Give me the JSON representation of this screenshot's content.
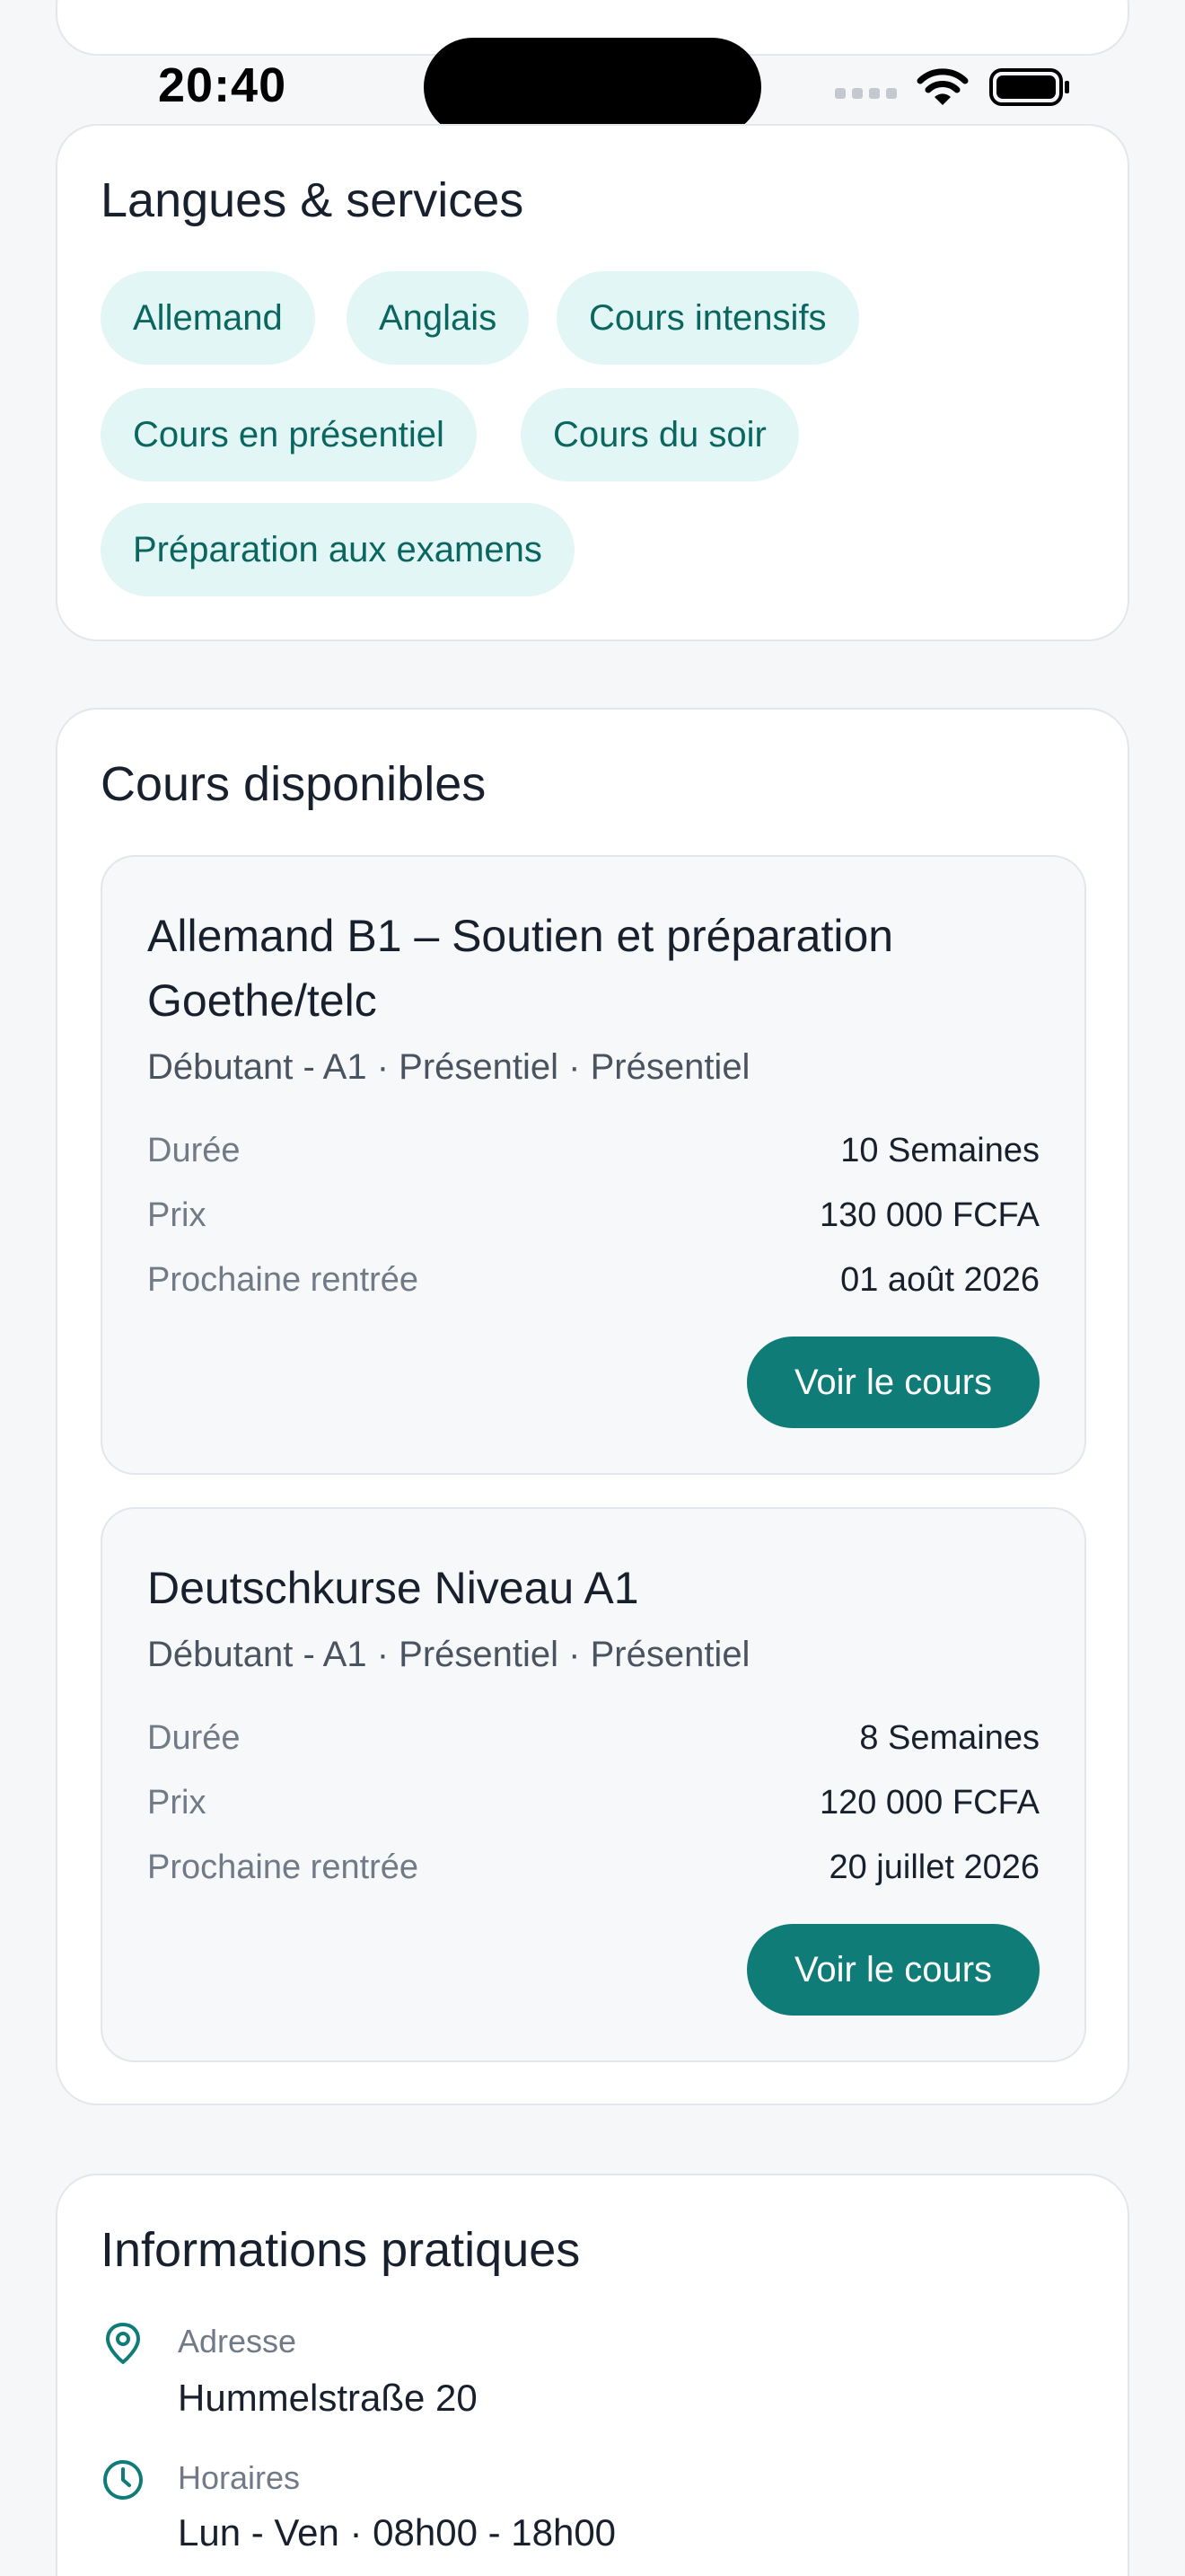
{
  "status_bar": {
    "time": "20:40"
  },
  "languages_card": {
    "title": "Langues & services",
    "chips": [
      "Allemand",
      "Anglais",
      "Cours intensifs",
      "Cours en présentiel",
      "Cours du soir",
      "Préparation aux examens"
    ]
  },
  "courses_card": {
    "title": "Cours disponibles",
    "courses": [
      {
        "title": "Allemand B1 – Soutien et préparation Goethe/telc",
        "meta": "Débutant - A1 · Présentiel · Présentiel",
        "duration_label": "Durée",
        "duration_value": "10 Semaines",
        "price_label": "Prix",
        "price_value": "130 000 FCFA",
        "start_label": "Prochaine rentrée",
        "start_value": "01 août 2026",
        "button_label": "Voir le cours"
      },
      {
        "title": "Deutschkurse Niveau A1",
        "meta": "Débutant - A1 · Présentiel · Présentiel",
        "duration_label": "Durée",
        "duration_value": "8 Semaines",
        "price_label": "Prix",
        "price_value": "120 000 FCFA",
        "start_label": "Prochaine rentrée",
        "start_value": "20 juillet 2026",
        "button_label": "Voir le cours"
      }
    ]
  },
  "info_card": {
    "title": "Informations pratiques",
    "address_label": "Adresse",
    "address_value": "Hummelstraße 20",
    "hours_label": "Horaires",
    "hours_value": "Lun - Ven · 08h00 - 18h00"
  },
  "colors": {
    "accent": "#0f7c78",
    "chip_background": "#e2f6f5",
    "chip_text": "#0b6660",
    "page_background": "#f5f7f9",
    "card_background": "#ffffff",
    "course_background": "#f6f8fa"
  },
  "icons": {
    "wifi": "wifi-icon",
    "battery": "battery-icon",
    "cellular": "cellular-icon",
    "address": "map-pin-icon",
    "hours": "clock-icon"
  }
}
